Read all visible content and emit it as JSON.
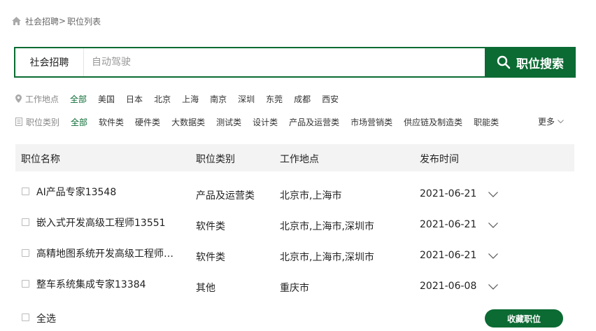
{
  "breadcrumb": {
    "parent": "社会招聘",
    "separator": ">",
    "current": "职位列表"
  },
  "search": {
    "category": "社会招聘",
    "value": "",
    "placeholder": "自动驾驶",
    "button": "职位搜索"
  },
  "location_filter": {
    "label": "工作地点",
    "options": [
      "全部",
      "美国",
      "日本",
      "北京",
      "上海",
      "南京",
      "深圳",
      "东莞",
      "成都",
      "西安"
    ],
    "selected": "全部"
  },
  "type_filter": {
    "label": "职位类别",
    "options": [
      "全部",
      "软件类",
      "硬件类",
      "大数据类",
      "测试类",
      "设计类",
      "产品及运营类",
      "市场营销类",
      "供应链及制造类",
      "职能类"
    ],
    "selected": "全部",
    "more": "更多"
  },
  "table": {
    "headers": [
      "职位名称",
      "职位类别",
      "工作地点",
      "发布时间"
    ],
    "rows": [
      {
        "name": "AI产品专家13548",
        "category": "产品及运营类",
        "location": "北京市,上海市",
        "date": "2021-06-21"
      },
      {
        "name": "嵌入式开发高级工程师13551",
        "category": "软件类",
        "location": "北京市,上海市,深圳市",
        "date": "2021-06-21"
      },
      {
        "name": "高精地图系统开发高级工程师…",
        "category": "软件类",
        "location": "北京市,上海市,深圳市",
        "date": "2021-06-21"
      },
      {
        "name": "整车系统集成专家13384",
        "category": "其他",
        "location": "重庆市",
        "date": "2021-06-08"
      }
    ]
  },
  "footer": {
    "select_all": "全选",
    "favorite_button": "收藏职位"
  },
  "colors": {
    "brand": "#0b6b33",
    "header_bg": "#f3f3f3"
  }
}
